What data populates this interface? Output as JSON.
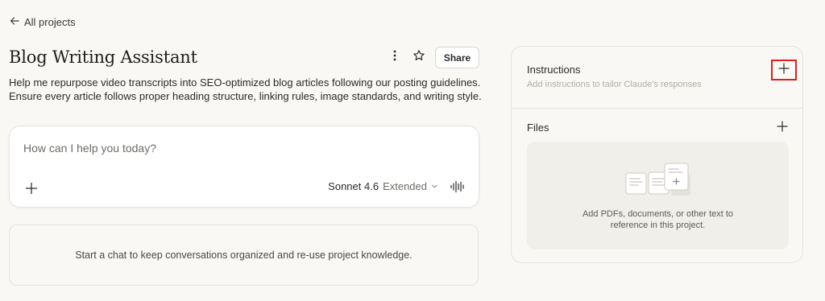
{
  "nav": {
    "back_label": "All projects"
  },
  "project": {
    "title": "Blog Writing Assistant",
    "description": "Help me repurpose video transcripts into SEO-optimized blog articles following our posting guidelines. Ensure every article follows proper heading structure, linking rules, image standards, and writing style.",
    "share_label": "Share"
  },
  "composer": {
    "placeholder": "How can I help you today?",
    "model_name": "Sonnet 4.6",
    "model_mode": "Extended"
  },
  "empty_state": {
    "text": "Start a chat to keep conversations organized and re-use project knowledge."
  },
  "side_panel": {
    "instructions_title": "Instructions",
    "instructions_subtitle": "Add instructions to tailor Claude's responses",
    "files_title": "Files",
    "files_dropzone_line1": "Add PDFs, documents, or other text to",
    "files_dropzone_line2": "reference in this project."
  },
  "colors": {
    "background": "#f9f8f5",
    "card": "#ffffff",
    "border": "#e6e3dc",
    "highlight": "#e02020"
  },
  "icons": [
    "arrow-left-icon",
    "more-vertical-icon",
    "star-icon",
    "plus-icon",
    "chevron-down-icon",
    "voice-waveform-icon",
    "documents-icon"
  ]
}
